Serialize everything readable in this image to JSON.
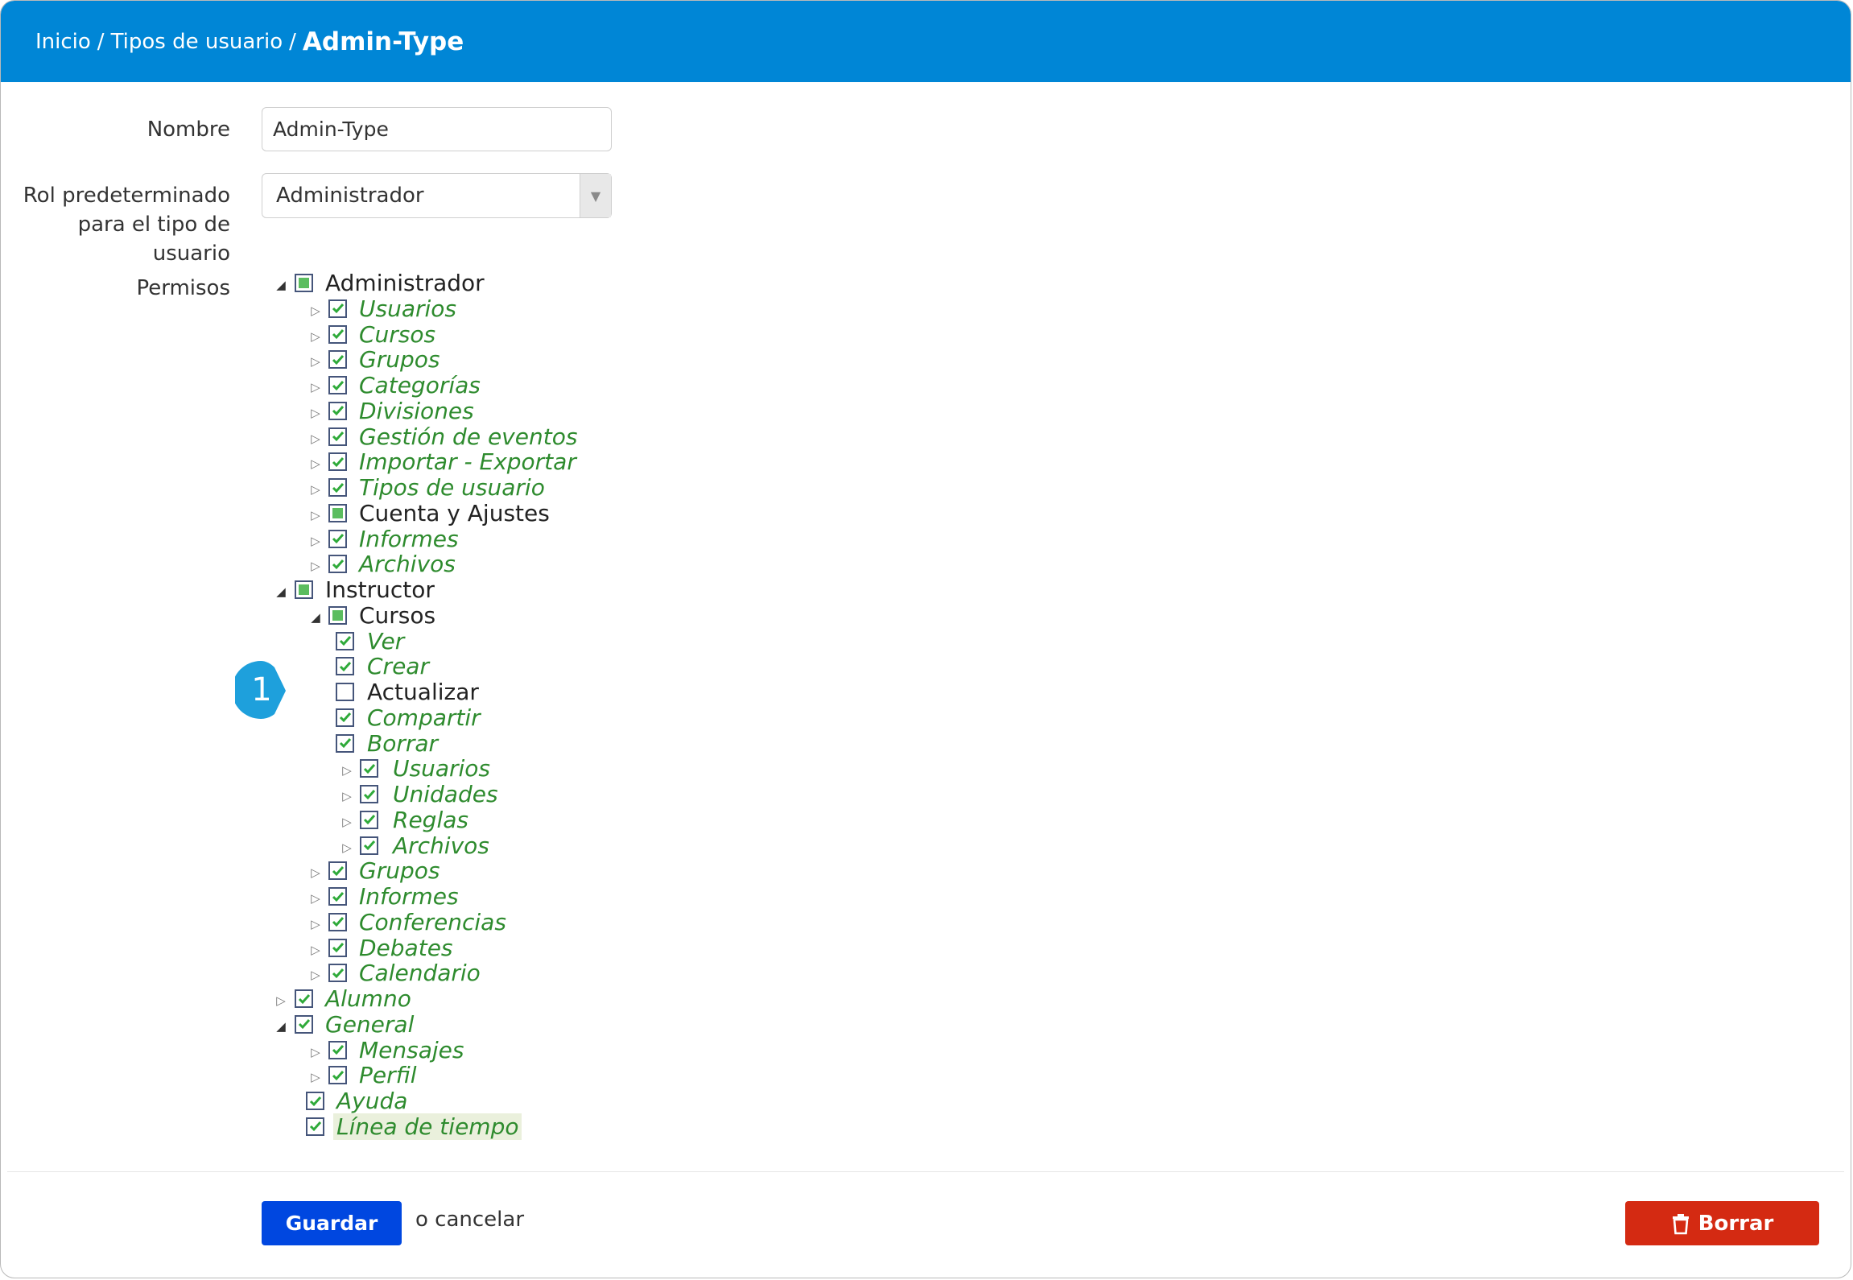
{
  "header": {
    "breadcrumb": [
      {
        "label": "Inicio"
      },
      {
        "label": "Tipos de usuario"
      }
    ],
    "separator": "/",
    "current": "Admin-Type"
  },
  "form": {
    "name_label": "Nombre",
    "name_value": "Admin-Type",
    "role_label_line1": "Rol predeterminado",
    "role_label_line2": "para el tipo de usuario",
    "role_value": "Administrador",
    "permissions_label": "Permisos"
  },
  "tree": [
    {
      "label": "Administrador",
      "level": 0,
      "toggle": "open",
      "state": "partial",
      "style": "normal"
    },
    {
      "label": "Usuarios",
      "level": 1,
      "toggle": "closed",
      "state": "checked",
      "style": "green"
    },
    {
      "label": "Cursos",
      "level": 1,
      "toggle": "closed",
      "state": "checked",
      "style": "green"
    },
    {
      "label": "Grupos",
      "level": 1,
      "toggle": "closed",
      "state": "checked",
      "style": "green"
    },
    {
      "label": "Categorías",
      "level": 1,
      "toggle": "closed",
      "state": "checked",
      "style": "green"
    },
    {
      "label": "Divisiones",
      "level": 1,
      "toggle": "closed",
      "state": "checked",
      "style": "green"
    },
    {
      "label": "Gestión de eventos",
      "level": 1,
      "toggle": "closed",
      "state": "checked",
      "style": "green"
    },
    {
      "label": "Importar - Exportar",
      "level": 1,
      "toggle": "closed",
      "state": "checked",
      "style": "green"
    },
    {
      "label": "Tipos de usuario",
      "level": 1,
      "toggle": "closed",
      "state": "checked",
      "style": "green"
    },
    {
      "label": "Cuenta y Ajustes",
      "level": 1,
      "toggle": "closed",
      "state": "partial",
      "style": "normal"
    },
    {
      "label": "Informes",
      "level": 1,
      "toggle": "closed",
      "state": "checked",
      "style": "green"
    },
    {
      "label": "Archivos",
      "level": 1,
      "toggle": "closed",
      "state": "checked",
      "style": "green"
    },
    {
      "label": "Instructor",
      "level": 0,
      "toggle": "open",
      "state": "partial",
      "style": "normal"
    },
    {
      "label": "Cursos",
      "level": 1,
      "toggle": "open",
      "state": "partial",
      "style": "normal"
    },
    {
      "label": "Ver",
      "level": 2,
      "toggle": "none",
      "state": "checked",
      "style": "green"
    },
    {
      "label": "Crear",
      "level": 2,
      "toggle": "none",
      "state": "checked",
      "style": "green"
    },
    {
      "label": "Actualizar",
      "level": 2,
      "toggle": "none",
      "state": "unchecked",
      "style": "normal"
    },
    {
      "label": "Compartir",
      "level": 2,
      "toggle": "none",
      "state": "checked",
      "style": "green"
    },
    {
      "label": "Borrar",
      "level": 2,
      "toggle": "none",
      "state": "checked",
      "style": "green"
    },
    {
      "label": "Usuarios",
      "level": 3,
      "toggle": "closed",
      "state": "checked",
      "style": "green"
    },
    {
      "label": "Unidades",
      "level": 3,
      "toggle": "closed",
      "state": "checked",
      "style": "green"
    },
    {
      "label": "Reglas",
      "level": 3,
      "toggle": "closed",
      "state": "checked",
      "style": "green"
    },
    {
      "label": "Archivos",
      "level": 3,
      "toggle": "closed",
      "state": "checked",
      "style": "green"
    },
    {
      "label": "Grupos",
      "level": 1,
      "toggle": "closed",
      "state": "checked",
      "style": "green"
    },
    {
      "label": "Informes",
      "level": 1,
      "toggle": "closed",
      "state": "checked",
      "style": "green"
    },
    {
      "label": "Conferencias",
      "level": 1,
      "toggle": "closed",
      "state": "checked",
      "style": "green"
    },
    {
      "label": "Debates",
      "level": 1,
      "toggle": "closed",
      "state": "checked",
      "style": "green"
    },
    {
      "label": "Calendario",
      "level": 1,
      "toggle": "closed",
      "state": "checked",
      "style": "green"
    },
    {
      "label": "Alumno",
      "level": 0,
      "toggle": "closed",
      "state": "checked",
      "style": "green"
    },
    {
      "label": "General",
      "level": 0,
      "toggle": "open",
      "state": "checked",
      "style": "green"
    },
    {
      "label": "Mensajes",
      "level": 1,
      "toggle": "closed",
      "state": "checked",
      "style": "green"
    },
    {
      "label": "Perfil",
      "level": 1,
      "toggle": "closed",
      "state": "checked",
      "style": "green"
    },
    {
      "label": "Ayuda",
      "level": 1,
      "toggle": "none",
      "state": "checked",
      "style": "green"
    },
    {
      "label": "Línea de tiempo",
      "level": 1,
      "toggle": "none",
      "state": "checked",
      "style": "green",
      "highlight": true
    }
  ],
  "footer": {
    "save_label": "Guardar",
    "cancel_text": "o cancelar",
    "delete_label": "Borrar"
  },
  "callout": {
    "number": "1"
  },
  "colors": {
    "header": "#0086d6",
    "checked_text": "#2e8b2e",
    "save_button": "#0047e0",
    "delete_button": "#d42a12",
    "callout": "#1ea0dc"
  }
}
